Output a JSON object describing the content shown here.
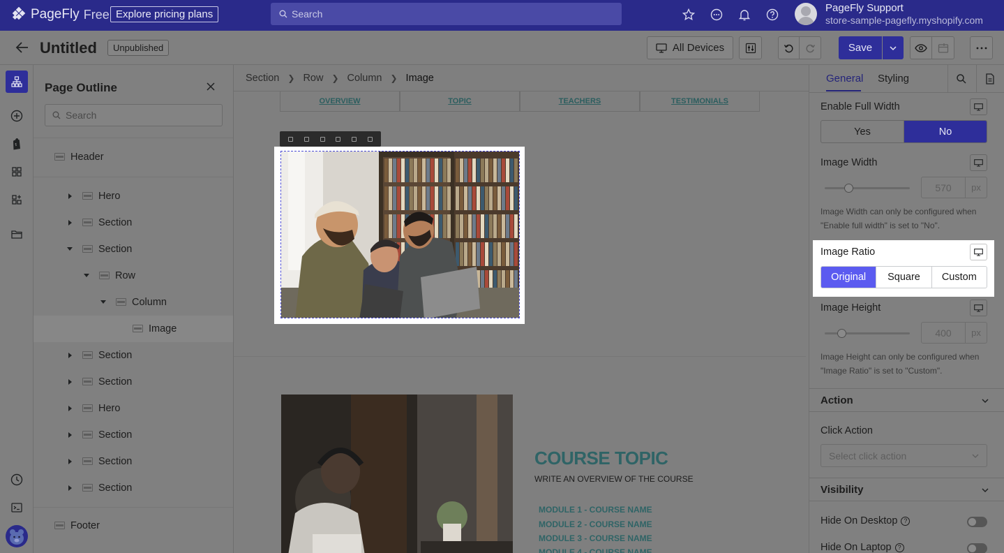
{
  "topbar": {
    "logo_name": "PageFly",
    "logo_tier": "Free",
    "explore_label": "Explore pricing plans",
    "search_placeholder": "Search",
    "icons": [
      "star-icon",
      "chat-icon",
      "bell-icon",
      "help-icon"
    ],
    "user_name": "PageFly Support",
    "user_store": "store-sample-pagefly.myshopify.com"
  },
  "header": {
    "title": "Untitled",
    "status_badge": "Unpublished",
    "devices_label": "All Devices",
    "save_label": "Save"
  },
  "outline": {
    "title": "Page Outline",
    "search_placeholder": "Search",
    "items": [
      {
        "label": "Header",
        "caret": "none",
        "level": 0
      },
      {
        "label": "Hero",
        "caret": "right",
        "level": 1
      },
      {
        "label": "Section",
        "caret": "right",
        "level": 1
      },
      {
        "label": "Section",
        "caret": "down",
        "level": 1
      },
      {
        "label": "Row",
        "caret": "down",
        "level": 2
      },
      {
        "label": "Column",
        "caret": "down",
        "level": 3
      },
      {
        "label": "Image",
        "caret": "none",
        "level": 4,
        "selected": true
      },
      {
        "label": "Section",
        "caret": "right",
        "level": 1
      },
      {
        "label": "Section",
        "caret": "right",
        "level": 1
      },
      {
        "label": "Hero",
        "caret": "right",
        "level": 1
      },
      {
        "label": "Section",
        "caret": "right",
        "level": 1
      },
      {
        "label": "Section",
        "caret": "right",
        "level": 1
      },
      {
        "label": "Section",
        "caret": "right",
        "level": 1
      },
      {
        "label": "Footer",
        "caret": "none",
        "level": 0
      }
    ]
  },
  "canvas": {
    "breadcrumb": [
      "Section",
      "Row",
      "Column",
      "Image"
    ],
    "nav_tabs": [
      "OVERVIEW",
      "TOPIC",
      "TEACHERS",
      "TESTIMONIALS"
    ],
    "course_title": "COURSE TOPIC",
    "course_subtitle": "WRITE AN OVERVIEW OF THE COURSE",
    "modules": [
      "MODULE 1 - COURSE NAME",
      "MODULE 2 - COURSE NAME",
      "MODULE 3 - COURSE NAME",
      "MODULE 4 - COURSE NAME"
    ]
  },
  "inspector": {
    "tabs": [
      "General",
      "Styling"
    ],
    "active_tab": "General",
    "full_width": {
      "label": "Enable Full Width",
      "options": [
        "Yes",
        "No"
      ],
      "selected": "No"
    },
    "image_width": {
      "label": "Image Width",
      "value": "570",
      "unit": "px",
      "slider_fraction": 0.28,
      "hint": "Image Width can only be configured when \"Enable full width\" is set to \"No\"."
    },
    "image_ratio": {
      "label": "Image Ratio",
      "options": [
        "Original",
        "Square",
        "Custom"
      ],
      "selected": "Original"
    },
    "image_height": {
      "label": "Image Height",
      "value": "400",
      "unit": "px",
      "slider_fraction": 0.2,
      "hint": "Image Height can only be configured when \"Image Ratio\" is set to \"Custom\"."
    },
    "action": {
      "title": "Action",
      "click_action_label": "Click Action",
      "click_action_placeholder": "Select click action"
    },
    "visibility": {
      "title": "Visibility",
      "hide_desktop": "Hide On Desktop",
      "hide_laptop": "Hide On Laptop"
    }
  },
  "colors": {
    "accent": "#2e2e9a",
    "topbar": "#2a2a8a",
    "teal_text": "#2f6466"
  }
}
